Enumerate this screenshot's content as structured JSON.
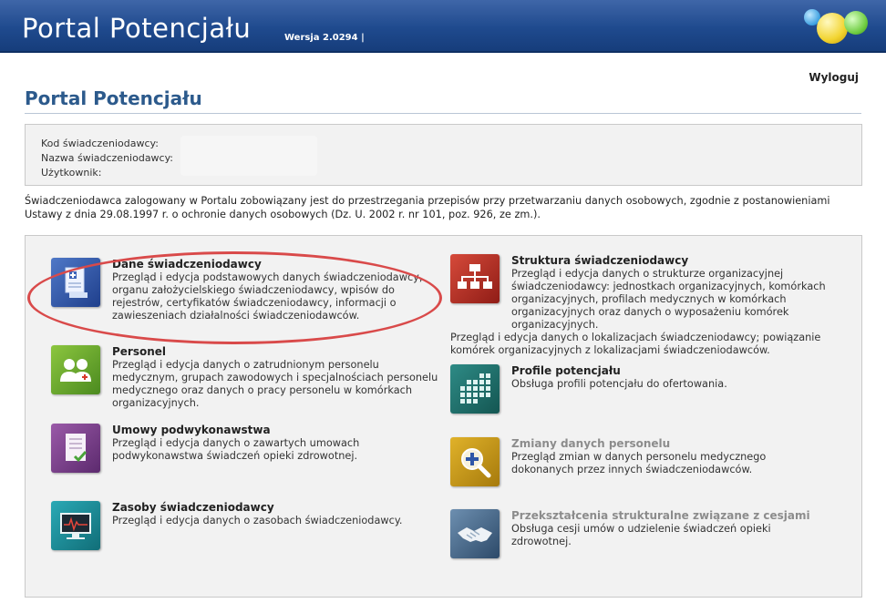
{
  "header": {
    "app_title": "Portal Potencjału",
    "version": "Wersja 2.0294 |"
  },
  "nav": {
    "logout_label": "Wyloguj"
  },
  "page": {
    "title": "Portal Potencjału"
  },
  "info_box": {
    "code_label": "Kod świadczeniodawcy:",
    "name_label": "Nazwa świadczeniodawcy:",
    "user_label": "Użytkownik:"
  },
  "notice": "Świadczeniodawca zalogowany w Portalu zobowiązany jest do przestrzegania przepisów przy przetwarzaniu danych osobowych, zgodnie z postanowieniami Ustawy z dnia 29.08.1997 r. o ochronie danych osobowych (Dz. U. 2002 r. nr 101, poz. 926, ze zm.).",
  "modules_left": [
    {
      "title": "Dane świadczeniodawcy",
      "desc": "Przegląd i edycja podstawowych danych świadczeniodawcy, organu założycielskiego świadczeniodawcy, wpisów do rejestrów, certyfikatów świadczeniodawcy, informacji o zawieszeniach działalności świadczeniodawców.",
      "icon": "document-icon",
      "color": "#2f57a8"
    },
    {
      "title": "Personel",
      "desc": "Przegląd i edycja danych o zatrudnionym personelu medycznym, grupach zawodowych i specjalnościach personelu medycznego oraz danych o pracy personelu w komórkach organizacyjnych.",
      "icon": "people-icon",
      "color": "#6aab2e"
    },
    {
      "title": "Umowy podwykonawstwa",
      "desc": "Przegląd i edycja danych o zawartych umowach podwykonawstwa świadczeń opieki zdrowotnej.",
      "icon": "contract-icon",
      "color": "#7b3f8c"
    },
    {
      "title": "Zasoby świadczeniodawcy",
      "desc": "Przegląd i edycja danych o zasobach świadczeniodawcy.",
      "icon": "monitor-icon",
      "color": "#1f8d98"
    }
  ],
  "modules_right": [
    {
      "title": "Struktura świadczeniodawcy",
      "desc": "Przegląd i edycja danych o strukturze organizacyjnej świadczeniodawcy: jednostkach organizacyjnych, komórkach organizacyjnych, profilach medycznych w komórkach organizacyjnych oraz danych o wyposażeniu komórek organizacyjnych.",
      "desc2": "Przegląd i edycja danych o lokalizacjach świadczeniodawcy; powiązanie komórek organizacyjnych z lokalizacjami świadczeniodawców.",
      "icon": "org-chart-icon",
      "color": "#b8332a"
    },
    {
      "title": "Profile potencjału",
      "desc": "Obsługa profili potencjału do ofertowania.",
      "icon": "grid-icon",
      "color": "#20706b"
    },
    {
      "title": "Zmiany danych personelu",
      "desc": "Przegląd zmian w danych personelu medycznego dokonanych przez innych świadczeniodawców.",
      "icon": "magnifier-icon",
      "color": "#c99a1a",
      "disabled": true
    },
    {
      "title": "Przekształcenia strukturalne związane z cesjami",
      "desc": "Obsługa cesji umów o udzielenie świadczeń opieki zdrowotnej.",
      "icon": "handshake-icon",
      "color": "#4a6a8c",
      "disabled": true
    }
  ]
}
